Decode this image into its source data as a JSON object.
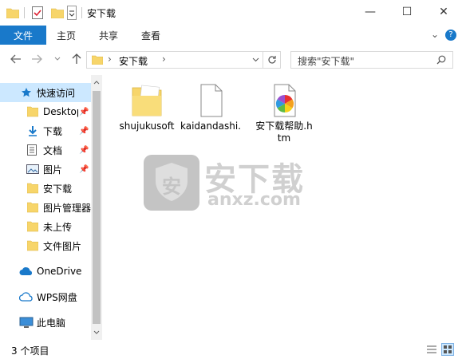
{
  "window": {
    "title": "安下载",
    "minimize_glyph": "—",
    "maximize_glyph": "☐",
    "close_glyph": "✕"
  },
  "ribbon": {
    "tabs": [
      {
        "label": "文件"
      },
      {
        "label": "主页"
      },
      {
        "label": "共享"
      },
      {
        "label": "查看"
      }
    ],
    "collapse_glyph": "⌄",
    "help_glyph": "?"
  },
  "address": {
    "path": "安下载",
    "search_placeholder": "搜索\"安下载\""
  },
  "nav": {
    "items": [
      {
        "label": "快速访问",
        "icon": "star-icon"
      },
      {
        "label": "Desktop",
        "icon": "folder-icon",
        "pinned": true
      },
      {
        "label": "下载",
        "icon": "download-arrow-icon",
        "pinned": true
      },
      {
        "label": "文档",
        "icon": "document-icon",
        "pinned": true
      },
      {
        "label": "图片",
        "icon": "picture-icon",
        "pinned": true
      },
      {
        "label": "安下载",
        "icon": "folder-icon"
      },
      {
        "label": "图片管理器",
        "icon": "folder-icon"
      },
      {
        "label": "未上传",
        "icon": "folder-icon"
      },
      {
        "label": "文件图片",
        "icon": "folder-icon"
      },
      {
        "label": "OneDrive",
        "icon": "cloud-icon"
      },
      {
        "label": "WPS网盘",
        "icon": "cloud-outline-icon"
      },
      {
        "label": "此电脑",
        "icon": "computer-icon"
      }
    ]
  },
  "files": [
    {
      "name": "shujukusoft",
      "type": "folder"
    },
    {
      "name": "kaidandashi.",
      "type": "file"
    },
    {
      "name": "安下载帮助.htm",
      "type": "htm"
    }
  ],
  "status": {
    "count": "3 个项目"
  },
  "watermark": {
    "cn": "安下载",
    "en": "anxz.com",
    "badge": "安"
  },
  "colors": {
    "accent": "#1979ca",
    "selection": "#cce8ff",
    "folder": "#f7d56a"
  }
}
